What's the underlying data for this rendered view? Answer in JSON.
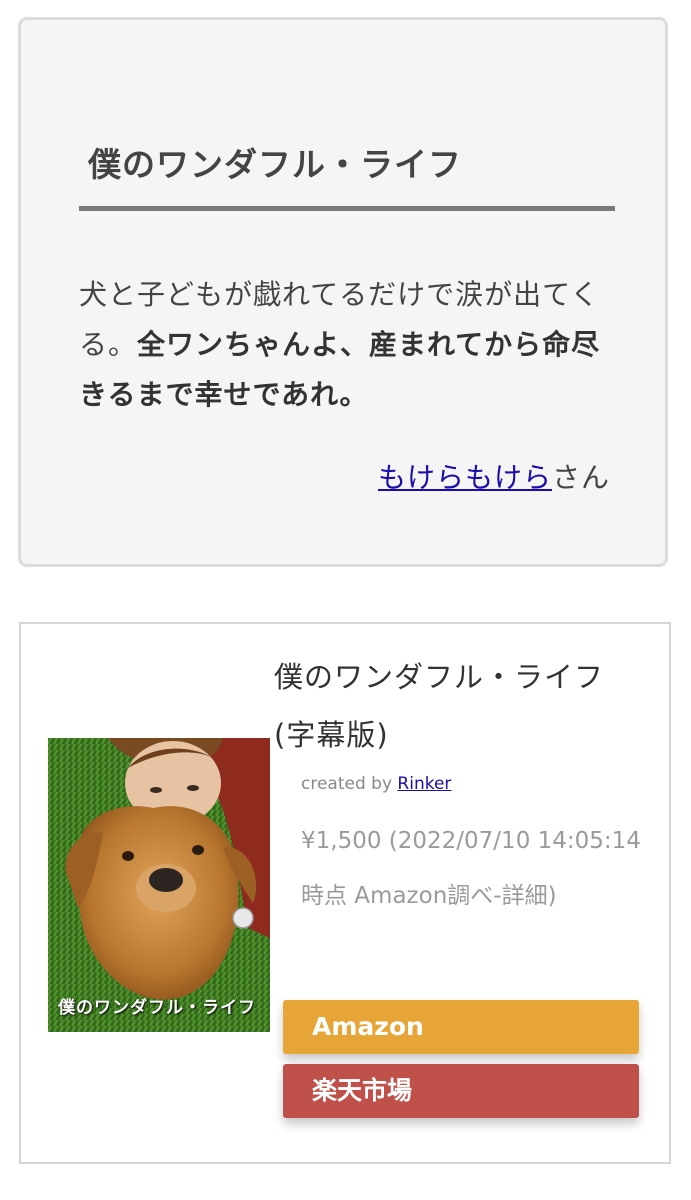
{
  "review": {
    "title": "僕のワンダフル・ライフ",
    "body_plain": "犬と子どもが戯れてるだけで涙が出てくる。",
    "body_bold": "全ワンちゃんよ、産まれてから命尽きるまで幸せであれ。",
    "author_name": "もけらもけら",
    "author_suffix": "さん"
  },
  "product": {
    "title": "僕のワンダフル・ライフ (字幕版)",
    "created_by_label": "created by",
    "created_by_link": "Rinker",
    "price_info": "¥1,500 (2022/07/10 14:05:14時点 Amazon調べ-詳細)",
    "poster_caption": "僕のワンダフル・ライフ",
    "buttons": {
      "amazon": "Amazon",
      "rakuten": "楽天市場"
    }
  },
  "colors": {
    "amazon_button": "#e8a537",
    "rakuten_button": "#c0504a",
    "link": "#1a0dab"
  }
}
